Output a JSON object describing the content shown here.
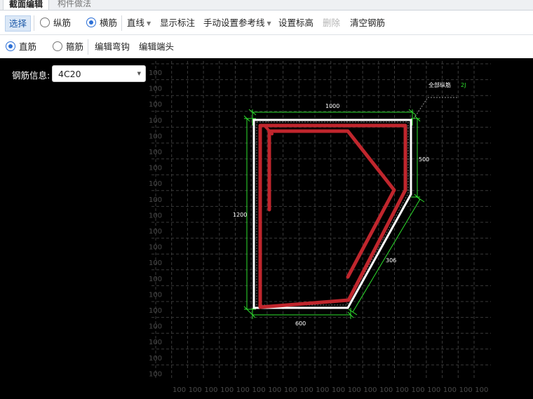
{
  "tabs": [
    "截面编辑",
    "构件做法"
  ],
  "toolbar1": {
    "select": "选择",
    "radio_longitudinal": "纵筋",
    "radio_transverse": "横筋",
    "line_mode": "直线",
    "show_dimension": "显示标注",
    "manual_ref_line": "手动设置参考线",
    "set_elevation": "设置标高",
    "delete": "删除",
    "clear_rebar": "清空钢筋"
  },
  "toolbar2": {
    "radio_straight": "直筋",
    "radio_stirrup": "箍筋",
    "edit_hook": "编辑弯钩",
    "edit_end": "编辑端头"
  },
  "rebar_info": {
    "label": "钢筋信息:",
    "value": "4C20"
  },
  "drawing": {
    "grid_label": "100",
    "annotation_text": "全部纵筋",
    "annotation_code": "2J",
    "dim_top": "1000",
    "dim_right": "500",
    "dim_left": "1200",
    "dim_slant": "306",
    "dim_bottom": "600"
  },
  "colors": {
    "canvas_bg": "#000000",
    "rebar": "#c0262d",
    "dimension": "#2ee02e",
    "outline": "#ffffff",
    "accent": "#2b6fd6"
  }
}
